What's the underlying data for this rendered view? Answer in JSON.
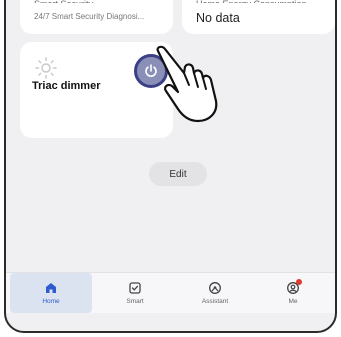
{
  "top_cards": {
    "left": {
      "header_clip": "Smart Security",
      "subtitle": "24/7 Smart Security Diagnosi..."
    },
    "right": {
      "header_clip": "Home Energy Consumption",
      "value": "No data"
    }
  },
  "device_card": {
    "name": "Triac dimmer",
    "icon": "sun-icon",
    "power_icon": "power-icon",
    "power_color": "#8a8fb8",
    "power_ring_color": "#3b3f85"
  },
  "edit_button": {
    "label": "Edit"
  },
  "tabbar": {
    "tabs": [
      {
        "label": "Home",
        "icon": "home-icon",
        "active": true
      },
      {
        "label": "Smart",
        "icon": "smart-icon",
        "active": false
      },
      {
        "label": "Assistant",
        "icon": "assistant-icon",
        "active": false
      },
      {
        "label": "Me",
        "icon": "me-icon",
        "active": false,
        "badge": true
      }
    ],
    "active_color": "#2f5bd0",
    "badge_color": "#e03a2c"
  }
}
